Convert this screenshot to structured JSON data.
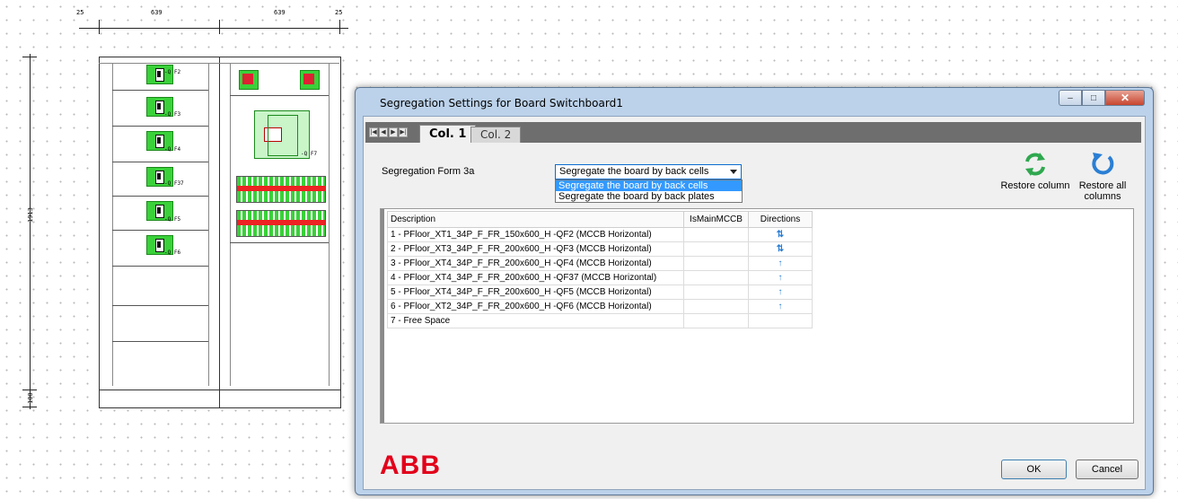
{
  "drawing": {
    "dims_top": [
      "25",
      "639",
      "639",
      "25"
    ],
    "dim_left_height": "1913",
    "dim_left_base": "100",
    "breaker_labels": [
      "-Q F2",
      "-Q F3",
      "-Q F4",
      "-Q F37",
      "-Q F5",
      "-Q F6"
    ],
    "right_labels": [
      "-Q F7"
    ]
  },
  "dialog": {
    "title": "Segregation Settings for Board Switchboard1",
    "window_buttons": {
      "minimize": "–",
      "maximize": "□",
      "close": "✕"
    },
    "nav_buttons": [
      "|◀",
      "◀",
      "▶",
      "▶|"
    ],
    "tabs": [
      "Col. 1",
      "Col. 2"
    ],
    "segregation_label": "Segregation Form 3a",
    "segregation_value": "Segregate the board by back cells",
    "segregation_options": [
      "Segregate the board by back cells",
      "Segregate the board by back plates"
    ],
    "restore_column": "Restore column",
    "restore_all": "Restore all columns",
    "columns": [
      "Description",
      "IsMainMCCB",
      "Directions"
    ],
    "rows": [
      {
        "desc": "1 - PFloor_XT1_34P_F_FR_150x600_H -QF2 (MCCB Horizontal)",
        "main": "",
        "dir": "⇅"
      },
      {
        "desc": "2 - PFloor_XT3_34P_F_FR_200x600_H -QF3 (MCCB Horizontal)",
        "main": "",
        "dir": "⇅"
      },
      {
        "desc": "3 - PFloor_XT4_34P_F_FR_200x600_H -QF4 (MCCB Horizontal)",
        "main": "",
        "dir": "↑"
      },
      {
        "desc": "4 - PFloor_XT4_34P_F_FR_200x600_H -QF37 (MCCB Horizontal)",
        "main": "",
        "dir": "↑"
      },
      {
        "desc": "5 - PFloor_XT4_34P_F_FR_200x600_H -QF5 (MCCB Horizontal)",
        "main": "",
        "dir": "↑"
      },
      {
        "desc": "6 - PFloor_XT2_34P_F_FR_200x600_H -QF6 (MCCB Horizontal)",
        "main": "",
        "dir": "↑"
      },
      {
        "desc": "7 - Free Space",
        "main": "",
        "dir": ""
      }
    ],
    "logo": "ABB",
    "ok": "OK",
    "cancel": "Cancel"
  },
  "colors": {
    "accent_green": "#2fa84f",
    "accent_blue": "#2a7fd4",
    "abb_red": "#e2001a",
    "selection": "#3399ff"
  }
}
